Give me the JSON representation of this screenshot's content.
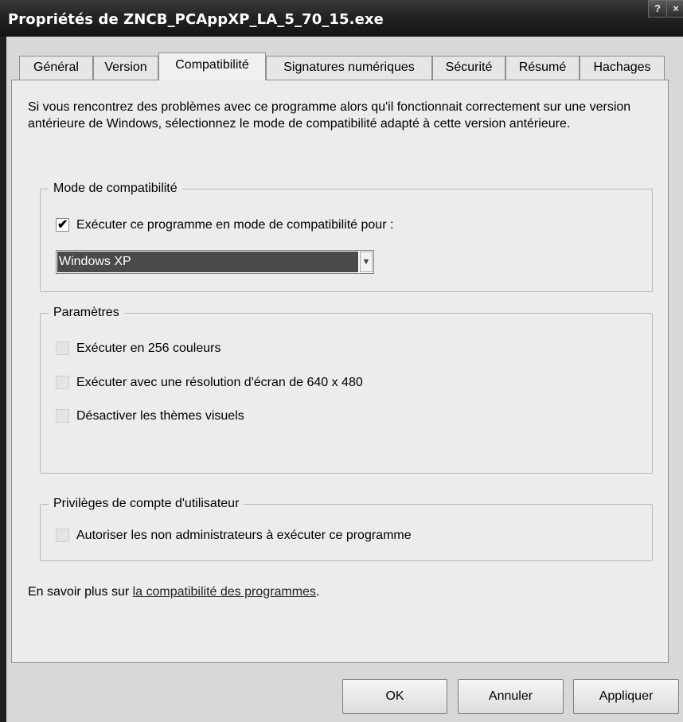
{
  "window": {
    "title": "Propriétés de ZNCB_PCAppXP_LA_5_70_15.exe",
    "help_button": "?",
    "close_button": "×"
  },
  "tabs": [
    {
      "label": "Général",
      "active": false
    },
    {
      "label": "Version",
      "active": false
    },
    {
      "label": "Compatibilité",
      "active": true
    },
    {
      "label": "Signatures numériques",
      "active": false
    },
    {
      "label": "Sécurité",
      "active": false
    },
    {
      "label": "Résumé",
      "active": false
    },
    {
      "label": "Hachages",
      "active": false
    }
  ],
  "intro_text": "Si vous rencontrez des problèmes avec ce programme alors qu'il fonctionnait correctement sur une version antérieure de Windows, sélectionnez le mode de compatibilité adapté à cette version antérieure.",
  "compat_mode": {
    "legend": "Mode de compatibilité",
    "checkbox_label": "Exécuter ce programme en mode de compatibilité pour :",
    "checked": true,
    "select_value": "Windows XP"
  },
  "settings": {
    "legend": "Paramètres",
    "options": [
      {
        "label": "Exécuter en 256 couleurs",
        "checked": false
      },
      {
        "label": "Exécuter avec une résolution d'écran de 640 x 480",
        "checked": false
      },
      {
        "label": "Désactiver les thèmes visuels",
        "checked": false
      }
    ]
  },
  "privileges": {
    "legend": "Privilèges de compte d'utilisateur",
    "checkbox_label": "Autoriser les non administrateurs à exécuter ce programme",
    "checked": false
  },
  "learn_more": {
    "prefix": "En savoir plus sur ",
    "link": "la compatibilité des programmes",
    "suffix": "."
  },
  "buttons": {
    "ok": "OK",
    "cancel": "Annuler",
    "apply": "Appliquer"
  }
}
